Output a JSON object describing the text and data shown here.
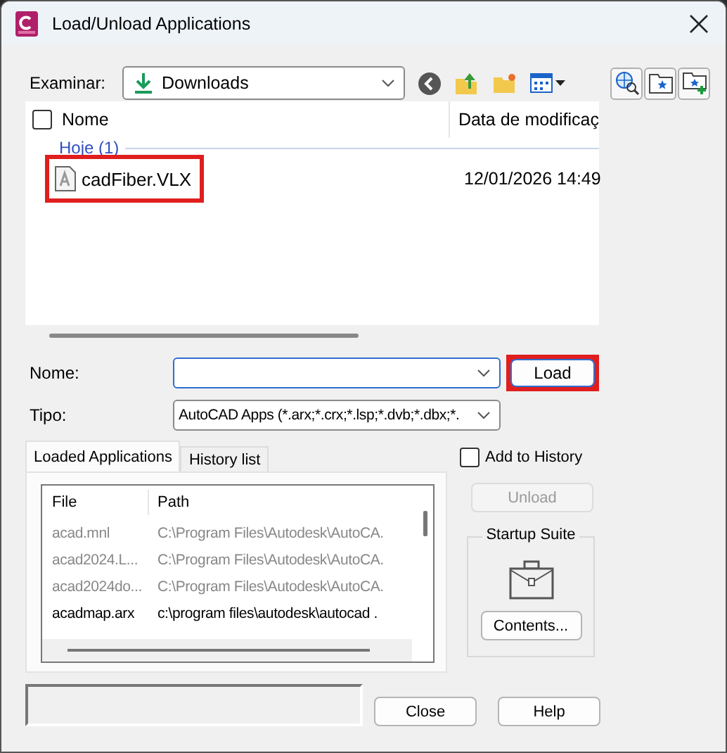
{
  "window": {
    "title": "Load/Unload Applications"
  },
  "look_in": {
    "label": "Examinar:",
    "value": "Downloads"
  },
  "file_list": {
    "columns": [
      "Nome",
      "Data de modificaç"
    ],
    "select_all_checked": false,
    "group": "Hoje (1)",
    "files": [
      {
        "name": "cadFiber.VLX",
        "modified": "12/01/2026 14:49",
        "highlighted": true
      }
    ]
  },
  "name_field": {
    "label": "Nome:"
  },
  "load_button": {
    "label": "Load",
    "highlighted": true
  },
  "type_field": {
    "label": "Tipo:",
    "value": "AutoCAD Apps (*.arx;*.crx;*.lsp;*.dvb;*.dbx;*."
  },
  "tabs": [
    {
      "label": "Loaded Applications",
      "selected": true
    },
    {
      "label": "History list",
      "selected": false
    }
  ],
  "loaded_apps": {
    "columns": [
      "File",
      "Path"
    ],
    "rows": [
      {
        "file": "acad.mnl",
        "path": "C:\\Program Files\\Autodesk\\AutoCA.",
        "disabled": true
      },
      {
        "file": "acad2024.L...",
        "path": "C:\\Program Files\\Autodesk\\AutoCA.",
        "disabled": true
      },
      {
        "file": "acad2024do...",
        "path": "C:\\Program Files\\Autodesk\\AutoCA.",
        "disabled": true
      },
      {
        "file": "acadmap.arx",
        "path": "c:\\program files\\autodesk\\autocad .",
        "disabled": false
      }
    ]
  },
  "add_to_history": {
    "label": "Add to History",
    "checked": false
  },
  "unload_button": {
    "label": "Unload",
    "disabled": true
  },
  "startup_suite": {
    "title": "Startup Suite",
    "button": "Contents..."
  },
  "buttons": [
    {
      "label": "Close"
    },
    {
      "label": "Help"
    }
  ]
}
